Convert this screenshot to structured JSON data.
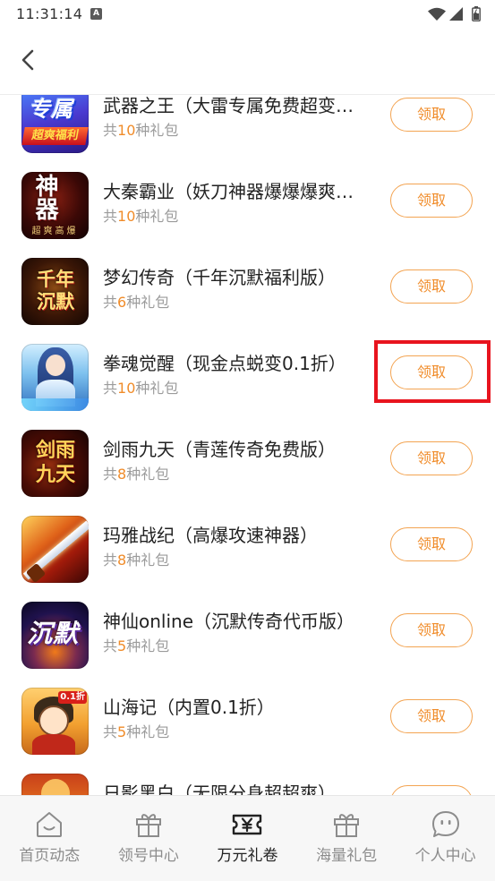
{
  "status_bar": {
    "time": "11:31:14",
    "notification_badge": "A",
    "icons": [
      "wifi-icon",
      "signal-icon",
      "battery-icon"
    ]
  },
  "header": {
    "back_icon": "chevron-left-icon"
  },
  "games": [
    {
      "title": "武器之王（大雷专属免费超变…",
      "gift_prefix": "共",
      "gift_count": "10",
      "gift_suffix": "种礼包",
      "action": "领取",
      "icon_text": [
        "专属",
        "超爽福利"
      ]
    },
    {
      "title": "大秦霸业（妖刀神器爆爆爆爽…",
      "gift_prefix": "共",
      "gift_count": "10",
      "gift_suffix": "种礼包",
      "action": "领取",
      "icon_text": [
        "神器",
        "超爽高爆"
      ]
    },
    {
      "title": "梦幻传奇（千年沉默福利版）",
      "gift_prefix": "共",
      "gift_count": "6",
      "gift_suffix": "种礼包",
      "action": "领取",
      "icon_text": [
        "千年沉默"
      ]
    },
    {
      "title": "拳魂觉醒（现金点蜕变0.1折）",
      "gift_prefix": "共",
      "gift_count": "10",
      "gift_suffix": "种礼包",
      "action": "领取",
      "highlighted": true
    },
    {
      "title": "剑雨九天（青莲传奇免费版）",
      "gift_prefix": "共",
      "gift_count": "8",
      "gift_suffix": "种礼包",
      "action": "领取",
      "icon_text": [
        "剑雨九天"
      ]
    },
    {
      "title": "玛雅战纪（高爆攻速神器）",
      "gift_prefix": "共",
      "gift_count": "8",
      "gift_suffix": "种礼包",
      "action": "领取"
    },
    {
      "title": "神仙online（沉默传奇代币版）",
      "gift_prefix": "共",
      "gift_count": "5",
      "gift_suffix": "种礼包",
      "action": "领取",
      "icon_text": [
        "沉默"
      ]
    },
    {
      "title": "山海记（内置0.1折）",
      "gift_prefix": "共",
      "gift_count": "5",
      "gift_suffix": "种礼包",
      "action": "领取",
      "icon_text": [
        "0.1折"
      ]
    },
    {
      "title": "日影黑白（无限分身超超爽）"
    }
  ],
  "bottom_nav": [
    {
      "label": "首页动态",
      "icon": "home-icon",
      "active": false
    },
    {
      "label": "领号中心",
      "icon": "gift-icon",
      "active": false
    },
    {
      "label": "万元礼卷",
      "icon": "ticket-yen-icon",
      "active": true
    },
    {
      "label": "海量礼包",
      "icon": "gift-icon",
      "active": false
    },
    {
      "label": "个人中心",
      "icon": "smiley-bubble-icon",
      "active": false
    }
  ],
  "colors": {
    "accent": "#f08c2a",
    "button_border": "#f3a452",
    "title_text": "#222222",
    "subtitle_text": "#9b9b9b",
    "nav_active": "#222222",
    "nav_inactive": "#8c8c8c",
    "highlight_box": "#e8141e"
  }
}
